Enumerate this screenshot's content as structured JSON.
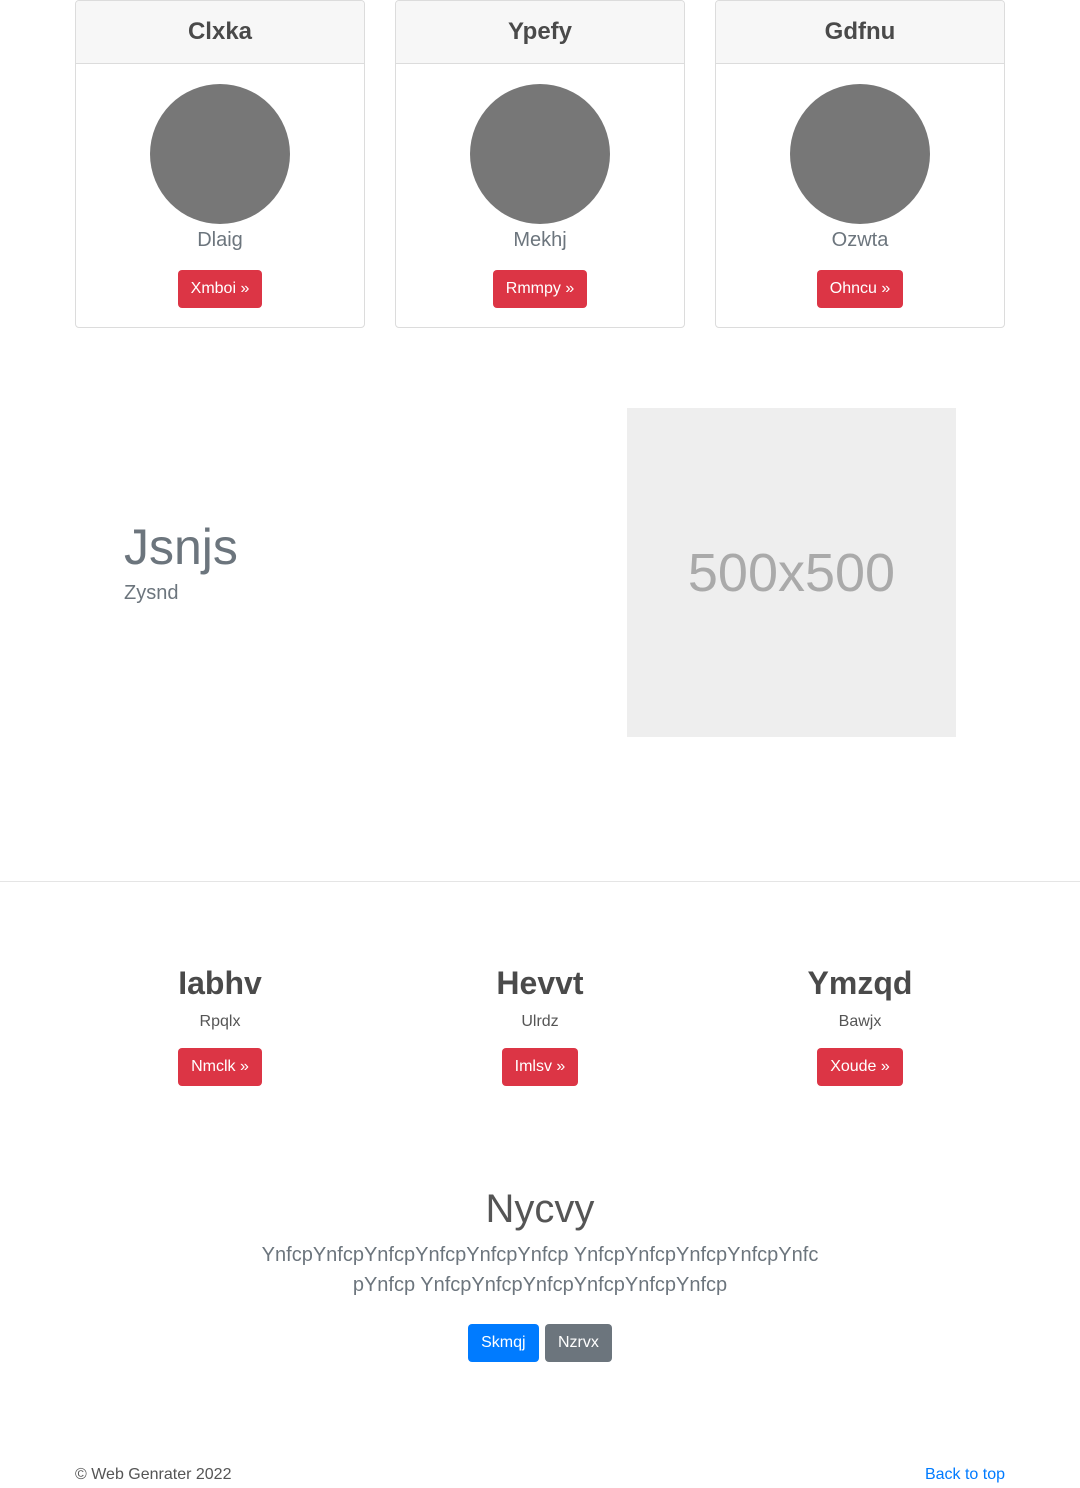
{
  "cards": [
    {
      "title": "Clxka",
      "subtitle": "Dlaig",
      "button": "Xmboi »"
    },
    {
      "title": "Ypefy",
      "subtitle": "Mekhj",
      "button": "Rmmpy »"
    },
    {
      "title": "Gdfnu",
      "subtitle": "Ozwta",
      "button": "Ohncu »"
    }
  ],
  "feature": {
    "title": "Jsnjs",
    "subtitle": "Zysnd",
    "placeholder_text": "500x500"
  },
  "columns": [
    {
      "title": "Iabhv",
      "subtitle": "Rpqlx",
      "button": "Nmclk »"
    },
    {
      "title": "Hevvt",
      "subtitle": "Ulrdz",
      "button": "Imlsv »"
    },
    {
      "title": "Ymzqd",
      "subtitle": "Bawjx",
      "button": "Xoude »"
    }
  ],
  "cta": {
    "title": "Nycvy",
    "text": "YnfcpYnfcpYnfcpYnfcpYnfcpYnfcp YnfcpYnfcpYnfcpYnfcpYnfcpYnfcp YnfcpYnfcpYnfcpYnfcpYnfcpYnfcp",
    "primary_button": "Skmqj",
    "secondary_button": "Nzrvx"
  },
  "footer": {
    "copyright": "© Web Genrater 2022",
    "back_to_top": "Back to top"
  },
  "colors": {
    "danger": "#dc3545",
    "primary": "#007bff",
    "secondary": "#6c757d"
  }
}
